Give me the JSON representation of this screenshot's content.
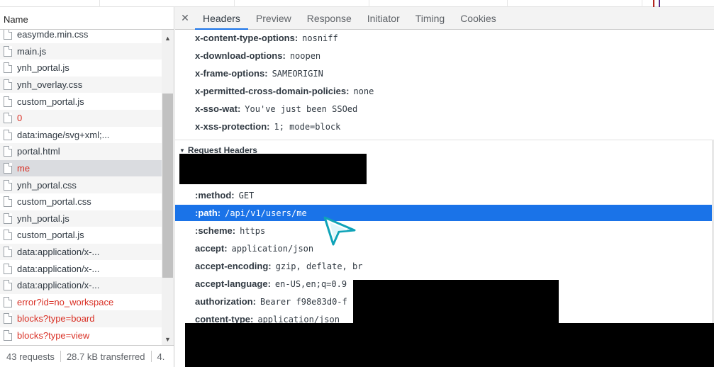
{
  "left_panel": {
    "header": "Name",
    "files": [
      {
        "name": "easymde.min.css",
        "error": false
      },
      {
        "name": "main.js",
        "error": false
      },
      {
        "name": "ynh_portal.js",
        "error": false
      },
      {
        "name": "ynh_overlay.css",
        "error": false
      },
      {
        "name": "custom_portal.js",
        "error": false
      },
      {
        "name": "0",
        "error": true
      },
      {
        "name": "data:image/svg+xml;...",
        "error": false
      },
      {
        "name": "portal.html",
        "error": false
      },
      {
        "name": "me",
        "error": true,
        "selected": true
      },
      {
        "name": "ynh_portal.css",
        "error": false
      },
      {
        "name": "custom_portal.css",
        "error": false
      },
      {
        "name": "ynh_portal.js",
        "error": false
      },
      {
        "name": "custom_portal.js",
        "error": false
      },
      {
        "name": "data:application/x-...",
        "error": false
      },
      {
        "name": "data:application/x-...",
        "error": false
      },
      {
        "name": "data:application/x-...",
        "error": false
      },
      {
        "name": "error?id=no_workspace",
        "error": true
      },
      {
        "name": "blocks?type=board",
        "error": true
      },
      {
        "name": "blocks?type=view",
        "error": true
      }
    ],
    "status": {
      "requests": "43 requests",
      "transferred": "28.7 kB transferred",
      "extra": "4."
    }
  },
  "right_panel": {
    "close_icon": "close-icon",
    "tabs": [
      {
        "label": "Headers",
        "active": true
      },
      {
        "label": "Preview",
        "active": false
      },
      {
        "label": "Response",
        "active": false
      },
      {
        "label": "Initiator",
        "active": false
      },
      {
        "label": "Timing",
        "active": false
      },
      {
        "label": "Cookies",
        "active": false
      }
    ],
    "response_headers": [
      {
        "name": "x-content-type-options:",
        "value": "nosniff"
      },
      {
        "name": "x-download-options:",
        "value": "noopen"
      },
      {
        "name": "x-frame-options:",
        "value": "SAMEORIGIN"
      },
      {
        "name": "x-permitted-cross-domain-policies:",
        "value": "none"
      },
      {
        "name": "x-sso-wat:",
        "value": "You've just been SSOed"
      },
      {
        "name": "x-xss-protection:",
        "value": "1; mode=block"
      }
    ],
    "request_section_title": "Request Headers",
    "request_headers": [
      {
        "name": ":method:",
        "value": "GET"
      },
      {
        "name": ":path:",
        "value": "/api/v1/users/me",
        "highlight": true
      },
      {
        "name": ":scheme:",
        "value": "https"
      },
      {
        "name": "accept:",
        "value": "application/json"
      },
      {
        "name": "accept-encoding:",
        "value": "gzip, deflate, br"
      },
      {
        "name": "accept-language:",
        "value": "en-US,en;q=0.9"
      },
      {
        "name": "authorization:",
        "value": "Bearer f98e83d0-f"
      },
      {
        "name": "content-type:",
        "value": "application/json"
      }
    ]
  },
  "colors": {
    "accent": "#1a73e8",
    "error_text": "#d93025",
    "selected_row": "#dadce0"
  }
}
